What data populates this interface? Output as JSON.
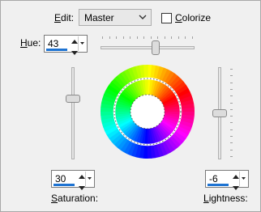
{
  "edit": {
    "label_u": "E",
    "label_rest": "dit:",
    "value": "Master"
  },
  "colorize": {
    "label_u": "C",
    "label_rest": "olorize",
    "checked": false
  },
  "hue": {
    "label_u": "H",
    "label_rest": "ue:",
    "value": "43",
    "level": 43
  },
  "saturation": {
    "label_u": "S",
    "label_rest": "aturation:",
    "value": "30",
    "level": 30
  },
  "lightness": {
    "label_u": "L",
    "label_rest": "ightness:",
    "value": "-6",
    "level": -6
  },
  "accent_color": "#1e73d2",
  "icons": {
    "dropdown": "chevron-down-icon",
    "spin_up": "triangle-up-icon",
    "spin_down": "triangle-down-icon",
    "wheel": "color-wheel-icon"
  }
}
